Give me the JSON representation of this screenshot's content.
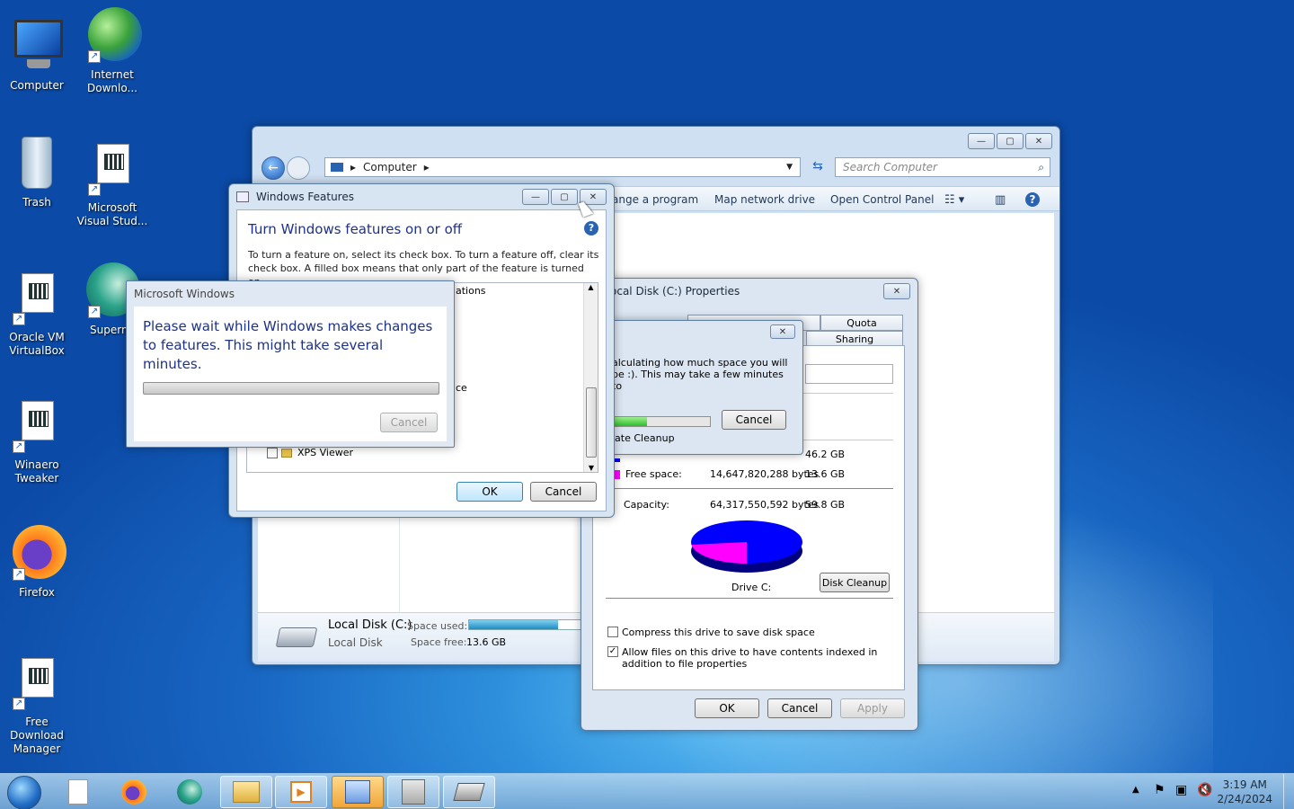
{
  "desktop_icons": [
    {
      "label": "Computer"
    },
    {
      "label": "Internet Downlo..."
    },
    {
      "label": "Trash"
    },
    {
      "label": "Microsoft Visual Stud..."
    },
    {
      "label": "Oracle VM VirtualBox"
    },
    {
      "label": "Supermi"
    },
    {
      "label": "Winaero Tweaker"
    },
    {
      "label": "Firefox"
    },
    {
      "label": "Free Download Manager"
    }
  ],
  "explorer": {
    "address": "Computer",
    "search_placeholder": "Search Computer",
    "commands": [
      "ange a program",
      "Map network drive",
      "Open Control Panel"
    ],
    "details": {
      "drive_name": "Local Disk (C:)",
      "drive_type": "Local Disk",
      "space_used_label": "Space used:",
      "space_free_label": "Space free:",
      "space_free_value": "13.6 GB",
      "used_fraction": 0.77
    }
  },
  "features": {
    "title": "Windows Features",
    "heading": "Turn Windows features on or off",
    "description": "To turn a feature on, select its check box. To turn a feature off, clear its check box. A filled box means that only part of the feature is turned on.",
    "tree_fragments": [
      "ations",
      "ce"
    ],
    "tree_last_item": "XPS Viewer",
    "ok_label": "OK",
    "cancel_label": "Cancel"
  },
  "ms_windows": {
    "title": "Microsoft Windows",
    "message": "Please wait while Windows makes changes to features. This might take several minutes.",
    "cancel_label": "Cancel"
  },
  "props": {
    "title": "ocal Disk (C:) Properties",
    "tabs_top": [
      "Quota"
    ],
    "tabs_bottom": [
      "Sharing"
    ],
    "free_label": "Free space:",
    "free_bytes": "14,647,820,288 bytes",
    "free_gb": "13.6 GB",
    "used_gb": "46.2 GB",
    "capacity_label": "Capacity:",
    "capacity_bytes": "64,317,550,592 bytes",
    "capacity_gb": "59.8 GB",
    "drive_label": "Drive C:",
    "disk_cleanup_label": "Disk Cleanup",
    "compress_label": "Compress this drive to save disk space",
    "index_label": "Allow files on this drive to have contents indexed in addition to file properties",
    "ok_label": "OK",
    "cancel_label": "Cancel",
    "apply_label": "Apply",
    "used_color": "#0000ff",
    "free_color": "#ff00ff",
    "used_fraction": 0.77
  },
  "cleanup": {
    "message": "alculating how much space you will be :). This may take a few minutes to",
    "cancel_label": "Cancel",
    "status": "late Cleanup",
    "progress_fraction": 0.35
  },
  "taskbar": {
    "time": "3:19 AM",
    "date": "2/24/2024"
  }
}
